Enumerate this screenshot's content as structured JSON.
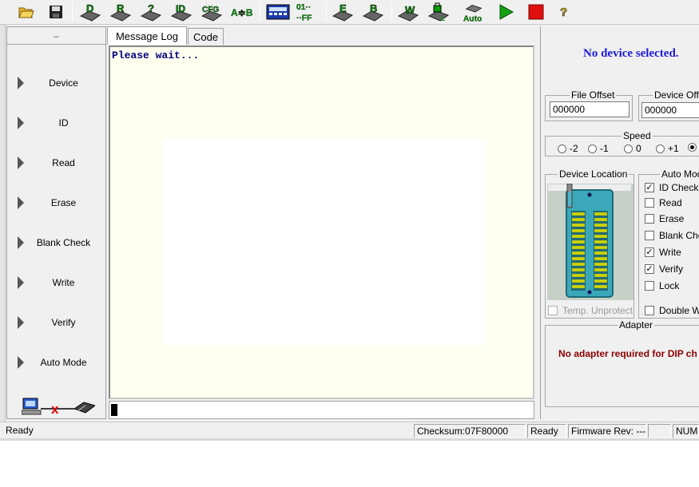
{
  "toolbar": {
    "buttons": [
      {
        "name": "open-icon"
      },
      {
        "name": "save-icon"
      },
      {
        "name": "device-icon",
        "label": "D"
      },
      {
        "name": "read-chip-icon",
        "label": "R"
      },
      {
        "name": "verify-chip-icon",
        "label": "?"
      },
      {
        "name": "id-chip-icon",
        "label": "ID"
      },
      {
        "name": "cfg-chip-icon",
        "label": "CFG"
      },
      {
        "name": "compare-icon",
        "label": "A≑B"
      },
      {
        "name": "calculator-icon"
      },
      {
        "name": "hex-toggle-icon",
        "label": "01"
      },
      {
        "name": "erase-chip-icon",
        "label": "E"
      },
      {
        "name": "blank-check-icon",
        "label": "B"
      },
      {
        "name": "write-chip-icon",
        "label": "W"
      },
      {
        "name": "lock-chip-icon",
        "label": "L"
      },
      {
        "name": "auto-icon",
        "label": "Auto"
      },
      {
        "name": "run-icon"
      },
      {
        "name": "stop-icon"
      },
      {
        "name": "help-icon",
        "label": "?"
      }
    ],
    "colors": {
      "chip_green": "#0a9a0a",
      "run_green": "#12a012",
      "stop_red": "#e01010",
      "help_yellow": "#e8c000"
    }
  },
  "sidebar": {
    "header": "–",
    "items": [
      {
        "label": "Device"
      },
      {
        "label": "ID"
      },
      {
        "label": "Read"
      },
      {
        "label": "Erase"
      },
      {
        "label": "Blank Check"
      },
      {
        "label": "Write"
      },
      {
        "label": "Verify"
      },
      {
        "label": "Auto Mode"
      }
    ]
  },
  "tabs": {
    "message_log": "Message Log",
    "code": "Code"
  },
  "log": {
    "text": "Please wait...",
    "colors": {
      "background": "#fffff0",
      "text": "#000080"
    }
  },
  "right": {
    "status": "No device selected.",
    "file_offset": {
      "label": "File Offset",
      "value": "000000"
    },
    "device_offset": {
      "label": "Device Offs",
      "value": "000000"
    },
    "speed": {
      "label": "Speed",
      "options": [
        "-2",
        "-1",
        "0",
        "+1",
        ""
      ],
      "selected_index": 4
    },
    "device_location": {
      "label": "Device Location"
    },
    "auto_mode": {
      "label": "Auto Mod",
      "options": [
        {
          "label": "ID Check",
          "checked": true
        },
        {
          "label": "Read",
          "checked": false
        },
        {
          "label": "Erase",
          "checked": false
        },
        {
          "label": "Blank Che",
          "checked": false
        },
        {
          "label": "Write",
          "checked": true
        },
        {
          "label": "Verify",
          "checked": true
        },
        {
          "label": "Lock",
          "checked": false
        }
      ]
    },
    "temp_unprotect": {
      "label": "Temp. Unprotect",
      "checked": false,
      "enabled": false
    },
    "double_w": {
      "label": "Double W",
      "checked": false
    },
    "adapter": {
      "label": "Adapter",
      "message": "No adapter required for DIP ch"
    },
    "colors": {
      "status_blue": "#1a1adc",
      "adapter_red": "#8b0000",
      "socket_teal": "#3aa8b8"
    }
  },
  "statusbar": {
    "state": "Ready",
    "checksum": "Checksum:07F80000",
    "ready2": "Ready",
    "firmware": "Firmware Rev: ---",
    "empty": "",
    "num": "NUM"
  }
}
